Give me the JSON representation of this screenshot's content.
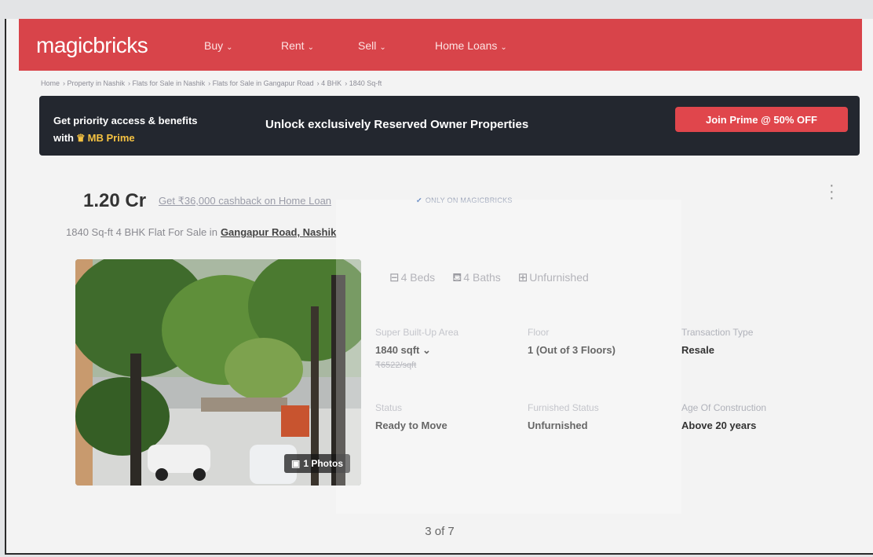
{
  "header": {
    "logo": "magicbricks",
    "nav": [
      {
        "label": "Buy"
      },
      {
        "label": "Rent"
      },
      {
        "label": "Sell"
      },
      {
        "label": "Home Loans"
      }
    ]
  },
  "breadcrumb": [
    "Home",
    "Property in Nashik",
    "Flats for Sale in Nashik",
    "Flats for Sale in Gangapur Road",
    "4 BHK",
    "1840 Sq-ft"
  ],
  "prime": {
    "line1": "Get priority access & benefits",
    "line2_prefix": "with",
    "line2_brand": "MB Prime",
    "unlock": "Unlock exclusively Reserved Owner Properties",
    "cta": "Join Prime @ 50% OFF"
  },
  "listing": {
    "price": "1.20 Cr",
    "cashback": "Get ₹36,000 cashback on Home Loan",
    "badge": "ONLY ON MAGICBRICKS",
    "subtitle_prefix": "1840 Sq-ft 4 BHK Flat For Sale in",
    "locality": "Gangapur Road, Nashik",
    "photos": "1 Photos",
    "amenities": [
      {
        "icon": "bed-icon",
        "glyph": "⊟",
        "label": "4 Beds"
      },
      {
        "icon": "bath-icon",
        "glyph": "⛾",
        "label": "4 Baths"
      },
      {
        "icon": "furnishing-icon",
        "glyph": "⊞",
        "label": "Unfurnished"
      }
    ],
    "details": [
      {
        "label": "Super Built-Up Area",
        "value": "1840 sqft",
        "sub": "₹6522/sqft"
      },
      {
        "label": "Floor",
        "value": "1 (Out of 3 Floors)"
      },
      {
        "label": "Transaction Type",
        "value": "Resale"
      },
      {
        "label": "Status",
        "value": "Ready to Move"
      },
      {
        "label": "Furnished Status",
        "value": "Unfurnished"
      },
      {
        "label": "Age Of Construction",
        "value": "Above 20 years"
      }
    ]
  },
  "pager": "3 of 7",
  "colors": {
    "brand": "#d8444a",
    "banner": "#23272f",
    "cta": "#e0464c",
    "crown": "#f5c242"
  }
}
